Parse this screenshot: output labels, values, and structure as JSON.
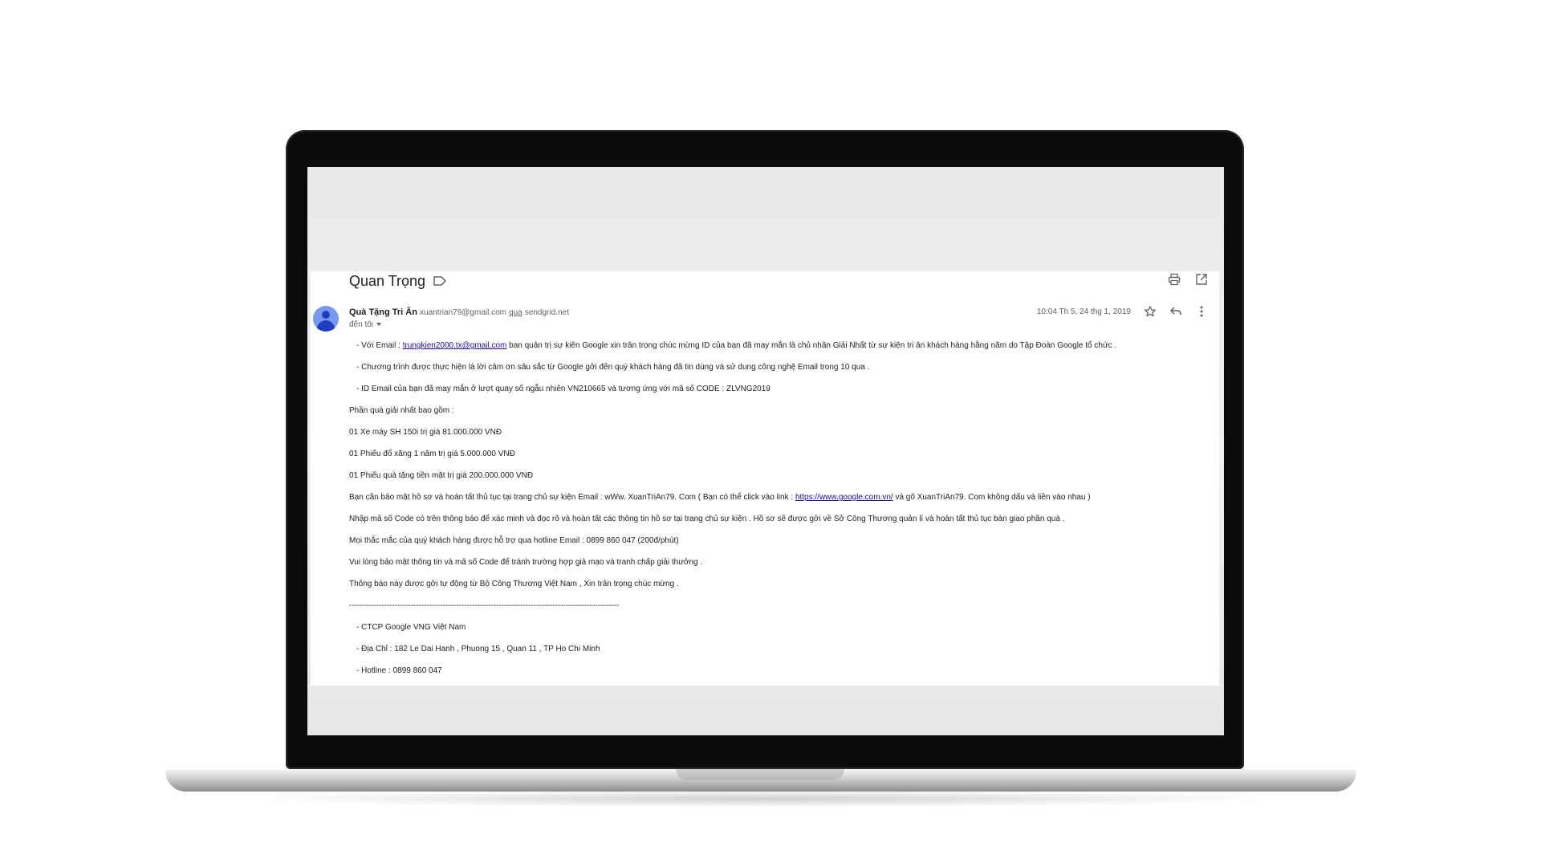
{
  "email": {
    "subject": "Quan Trọng",
    "sender_name": "Quà Tặng Tri Ân",
    "sender_email": "xuantrian79@gmail.com",
    "via_label": "qua",
    "via_domain": "sendgrid.net",
    "to_label": "đến tôi",
    "date": "10:04 Th 5, 24 thg 1, 2019",
    "icons": [
      "label-icon",
      "print-icon",
      "open-new-window-icon",
      "star-icon",
      "reply-icon",
      "more-vert-icon",
      "avatar-icon",
      "caret-down-icon"
    ]
  },
  "body": {
    "l1_pre": "- Với Email : ",
    "l1_link": "trungkien2000.tx@gmail.com",
    "l1_post": " ban quản trị sự kiên Google xin trân trọng chúc mừng ID của bạn đã may mắn là chủ nhân Giải Nhất từ sự kiện tri ân khách hàng hằng năm  do Tập Đoàn Google tổ chức .",
    "l2": "- Chương trình được thực hiện là lời cảm ơn sâu sắc từ Google gởi đến quý khách hàng đã tin dùng và sử dung công nghệ Email trong 10 qua .",
    "l3": "- ID Email của bạn đã may mắn ở lượt quay số ngẫu nhiên  VN210665 và tương ứng với mã số CODE : ZLVNG2019",
    "l4": "Phần quà giải nhất bao gồm :",
    "l5": "01 Xe máy SH 150i trị giá 81.000.000 VNĐ",
    "l6": "01 Phiếu đổ xăng 1 năm trị giá 5.000.000 VNĐ",
    "l7": "01 Phiếu quà tặng tiền mặt trị giá 200.000.000 VNĐ",
    "l8_pre": "Bạn cần bảo mật hồ sơ và hoàn tất thủ tục tại trang chủ sự kiện Email : wWw. XuanTriAn79. Com ( Bạn có thể click vào link : ",
    "l8_link": "https://www.google.com.vn/",
    "l8_post": " và gõ XuanTriAn79. Com không dấu và liền vào nhau )",
    "l9": "Nhập mã số Code có trên thông báo để xác minh và đọc rõ và hoàn tất các thông tin hồ sơ tại trang chủ sự kiện . Hồ sơ sẽ được gởi về Sở Công Thương quản lí và hoàn tất thủ tục bàn giao phần quà .",
    "l10": "Mọi thắc mắc của quý khách hàng được hỗ trợ qua hotline Email : 0899 860 047 (200đ/phút)",
    "l11": "Vui lòng bảo mật thông tin và mã số Code để tránh trường hợp giả mạo và tranh chấp giải thưởng .",
    "l12": "Thông báo này được gởi tự động từ Bộ Công Thương Việt Nam , Xin trân trọng chúc mừng .",
    "divider": "-----------------------------------------------------------------------------------------------------",
    "l13": "- CTCP Google VNG Việt Nam",
    "l14": "- Địa Chỉ : 182 Le Dai Hanh , Phuong 15 , Quan 11 , TP Ho Chi Minh",
    "l15": "- Hotline : 0899 860 047"
  }
}
